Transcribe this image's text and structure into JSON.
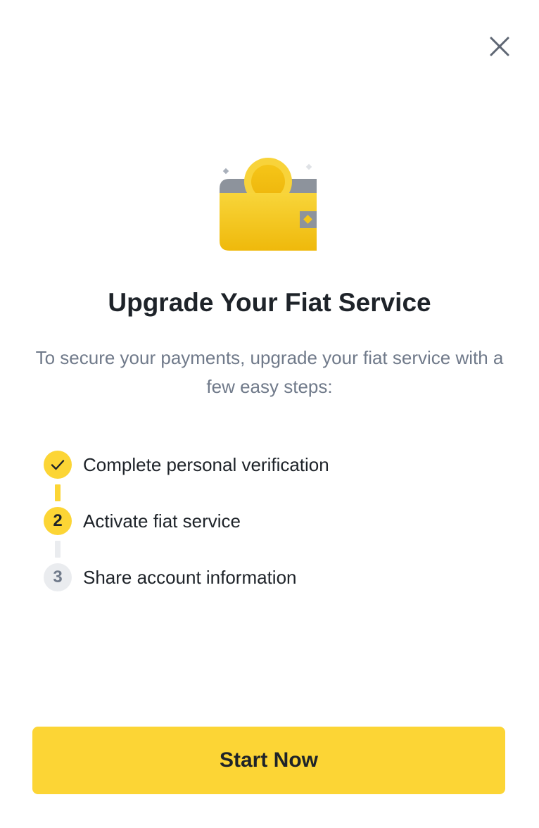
{
  "modal": {
    "title": "Upgrade Your Fiat Service",
    "subtitle": "To secure your payments, upgrade your fiat service with a few easy steps:",
    "close_icon": "close-icon",
    "hero_icon": "wallet-coin-icon"
  },
  "steps": [
    {
      "indicator": "",
      "label": "Complete personal verification",
      "status": "completed",
      "icon": "check-icon"
    },
    {
      "indicator": "2",
      "label": "Activate fiat service",
      "status": "active"
    },
    {
      "indicator": "3",
      "label": "Share account information",
      "status": "pending"
    }
  ],
  "cta": {
    "label": "Start Now"
  },
  "colors": {
    "accent": "#fcd535",
    "text_primary": "#1e2329",
    "text_secondary": "#707a8a",
    "pending": "#eaecef"
  }
}
